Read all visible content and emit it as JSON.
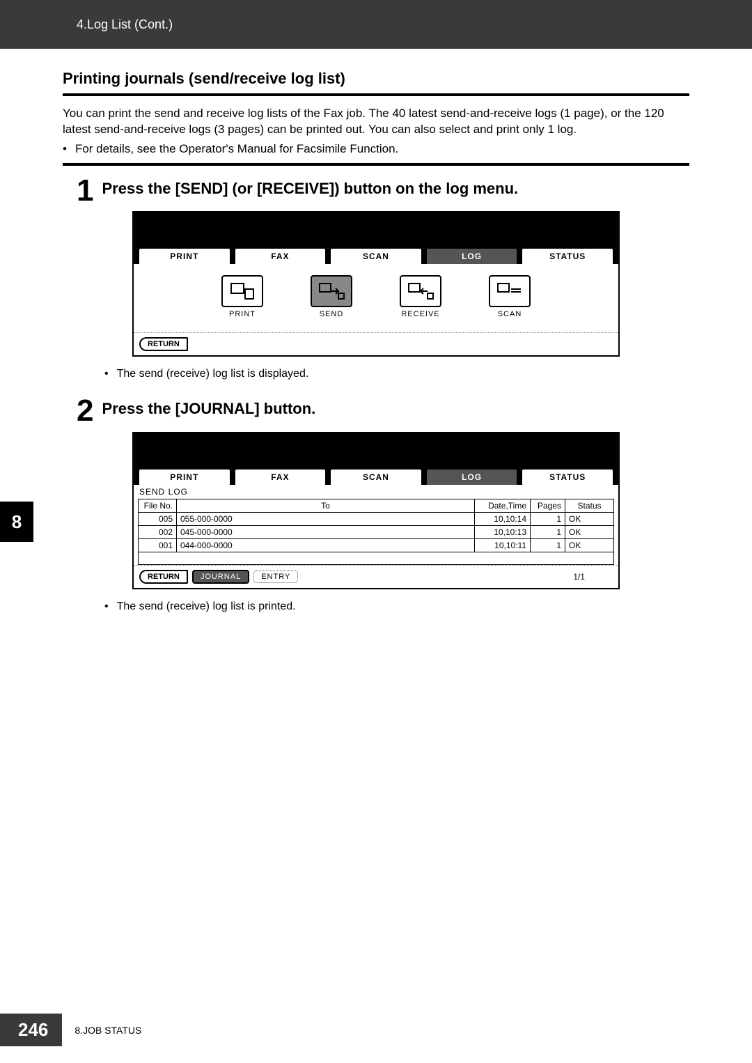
{
  "header": {
    "breadcrumb": "4.Log List (Cont.)"
  },
  "section": {
    "title": "Printing journals (send/receive log list)",
    "intro": "You can print the send and receive log lists of the Fax job. The 40 latest send-and-receive logs (1 page), or the 120 latest send-and-receive logs (3 pages) can be printed out. You can also select and print only 1 log.",
    "bullet": "For details, see the Operator's Manual for Facsimile Function."
  },
  "step1": {
    "num": "1",
    "title": "Press the [SEND] (or [RECEIVE]) button on the log menu.",
    "tabs": [
      "PRINT",
      "FAX",
      "SCAN",
      "LOG",
      "STATUS"
    ],
    "active_tab": "LOG",
    "icons": [
      {
        "name": "print-icon",
        "label": "PRINT"
      },
      {
        "name": "send-icon",
        "label": "SEND",
        "selected": true
      },
      {
        "name": "receive-icon",
        "label": "RECEIVE"
      },
      {
        "name": "scan-icon",
        "label": "SCAN"
      }
    ],
    "return_label": "RETURN",
    "note": "The send (receive) log list is displayed."
  },
  "step2": {
    "num": "2",
    "title": "Press the [JOURNAL] button.",
    "tabs": [
      "PRINT",
      "FAX",
      "SCAN",
      "LOG",
      "STATUS"
    ],
    "active_tab": "LOG",
    "table_label": "SEND LOG",
    "columns": {
      "file_no": "File No.",
      "to": "To",
      "datetime": "Date,Time",
      "pages": "Pages",
      "status": "Status"
    },
    "rows": [
      {
        "file_no": "005",
        "to": "055-000-0000",
        "datetime": "10,10:14",
        "pages": "1",
        "status": "OK"
      },
      {
        "file_no": "002",
        "to": "045-000-0000",
        "datetime": "10,10:13",
        "pages": "1",
        "status": "OK"
      },
      {
        "file_no": "001",
        "to": "044-000-0000",
        "datetime": "10,10:11",
        "pages": "1",
        "status": "OK"
      }
    ],
    "footer_buttons": {
      "return": "RETURN",
      "journal": "JOURNAL",
      "entry": "ENTRY"
    },
    "page_indicator": "1/1",
    "note": "The send (receive) log list is printed."
  },
  "side_tab": "8",
  "footer": {
    "page_number": "246",
    "chapter": "8.JOB STATUS"
  }
}
